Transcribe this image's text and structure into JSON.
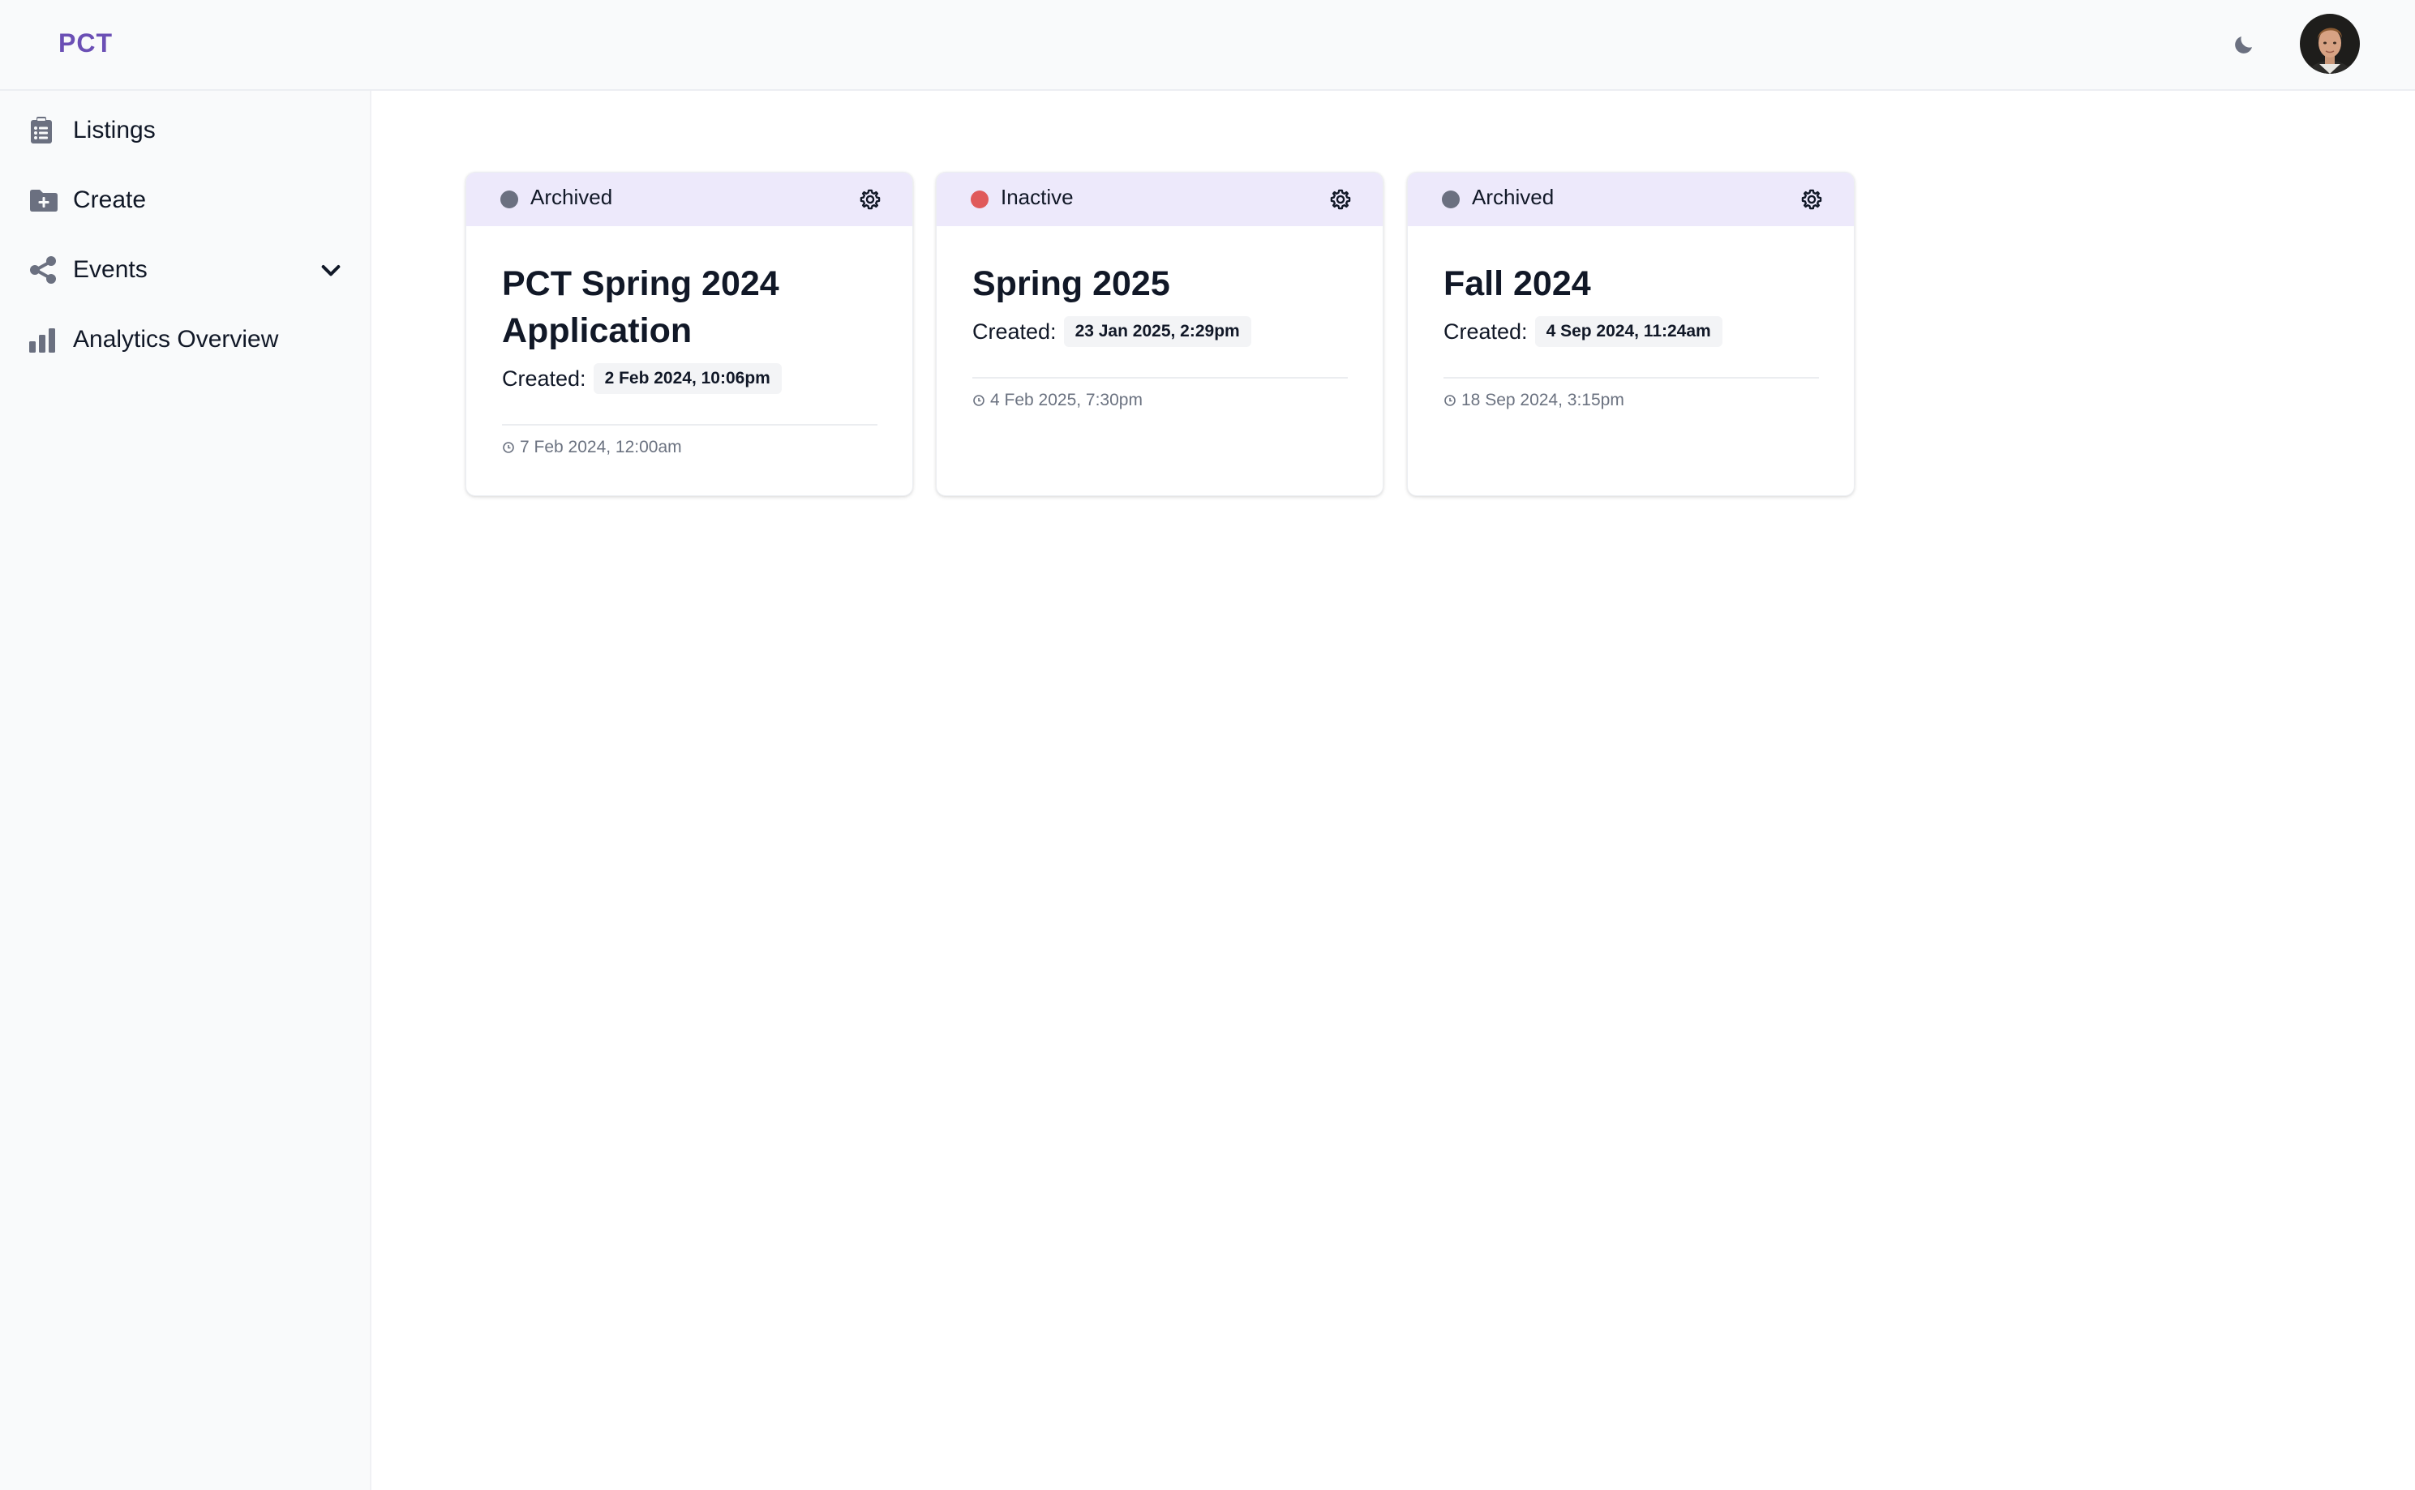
{
  "app": {
    "logo_text": "PCT",
    "theme_toggle_icon": "moon-icon",
    "avatar_icon": "user-avatar"
  },
  "colors": {
    "brand": "#6b4fb5",
    "status_archived": "#6b7080",
    "status_inactive": "#e05a5a",
    "card_header": "#ede9fb"
  },
  "sidebar": {
    "items": [
      {
        "label": "Listings",
        "icon": "clipboard-list-icon"
      },
      {
        "label": "Create",
        "icon": "folder-plus-icon"
      },
      {
        "label": "Events",
        "icon": "share-nodes-icon",
        "expandable": true
      },
      {
        "label": "Analytics Overview",
        "icon": "bar-chart-icon"
      }
    ]
  },
  "cards": [
    {
      "status": "Archived",
      "status_color": "#6b7080",
      "title": "PCT Spring 2024 Application",
      "created_label": "Created:",
      "created_date": "2 Feb 2024, 10:06pm",
      "updated_date": "7 Feb 2024, 12:00am"
    },
    {
      "status": "Inactive",
      "status_color": "#e05a5a",
      "title": "Spring 2025",
      "created_label": "Created:",
      "created_date": "23 Jan 2025, 2:29pm",
      "updated_date": "4 Feb 2025, 7:30pm"
    },
    {
      "status": "Archived",
      "status_color": "#6b7080",
      "title": "Fall 2024",
      "created_label": "Created:",
      "created_date": "4 Sep 2024, 11:24am",
      "updated_date": "18 Sep 2024, 3:15pm"
    }
  ]
}
